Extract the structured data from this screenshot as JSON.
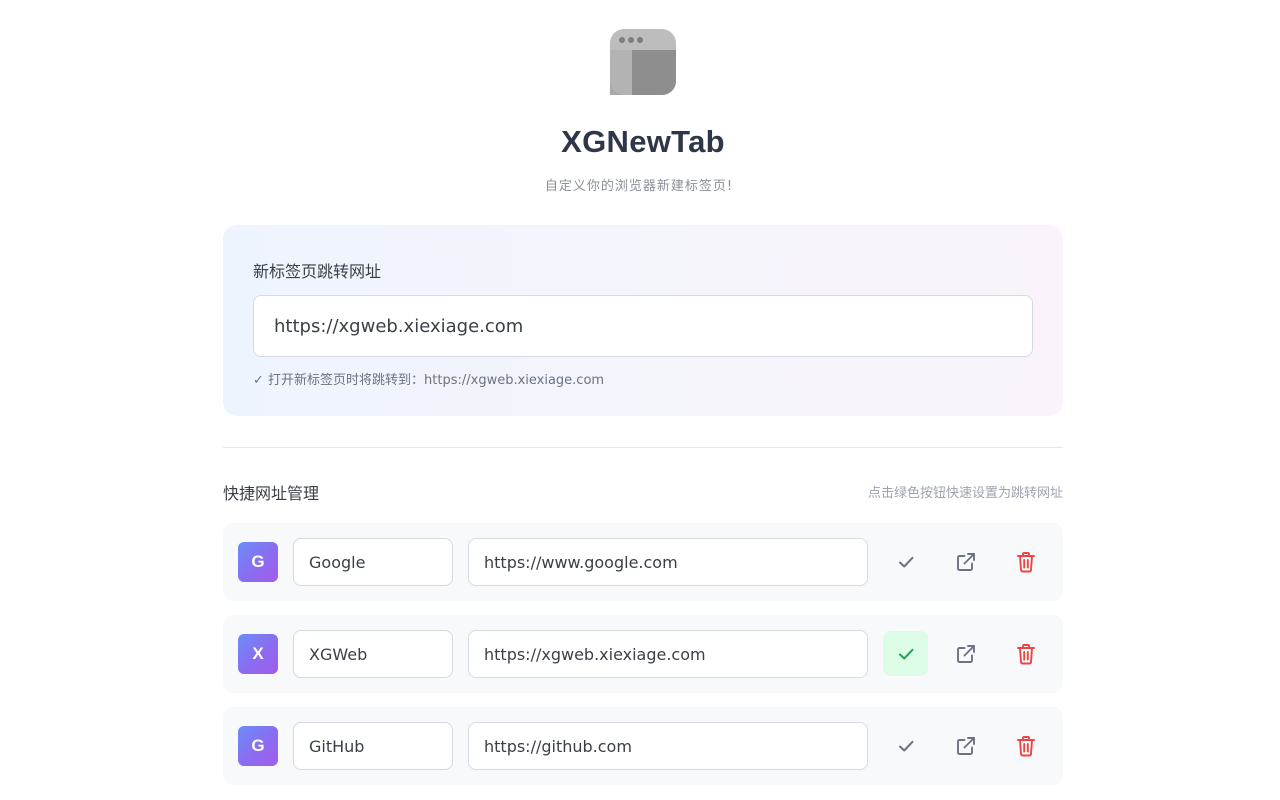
{
  "app": {
    "title": "XGNewTab",
    "subtitle": "自定义你的浏览器新建标签页!"
  },
  "redirect": {
    "label": "新标签页跳转网址",
    "value": "https://xgweb.xiexiage.com",
    "hint": "✓ 打开新标签页时将跳转到：https://xgweb.xiexiage.com"
  },
  "shortcuts": {
    "title": "快捷网址管理",
    "hint": "点击绿色按钮快速设置为跳转网址",
    "items": [
      {
        "initial": "G",
        "name": "Google",
        "url": "https://www.google.com",
        "active": false
      },
      {
        "initial": "X",
        "name": "XGWeb",
        "url": "https://xgweb.xiexiage.com",
        "active": true
      },
      {
        "initial": "G",
        "name": "GitHub",
        "url": "https://github.com",
        "active": false
      }
    ]
  },
  "colors": {
    "accent_gradient_start": "#6a8ef7",
    "accent_gradient_end": "#a25cec",
    "active_green": "#22a05a",
    "active_green_bg": "#dcfce7",
    "delete_red": "#ef4444"
  },
  "icons": {
    "logo": "browser-window-icon",
    "set": "check-icon",
    "open": "external-link-icon",
    "delete": "trash-icon"
  }
}
